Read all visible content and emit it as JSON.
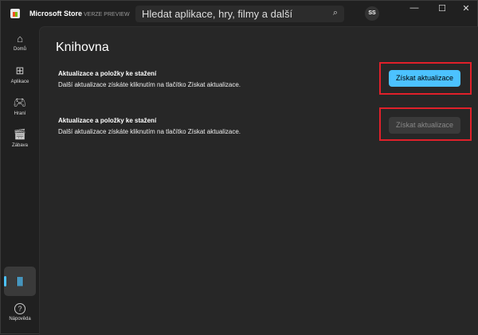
{
  "titlebar": {
    "app_name": "Microsoft Store",
    "badge": "VERZE PREVIEW",
    "search_placeholder": "Hledat aplikace, hry, filmy a další",
    "avatar": "SS",
    "minimize": "—",
    "maximize": "☐",
    "close": "✕"
  },
  "sidebar": {
    "items": [
      {
        "label": "Domů",
        "icon": "⌂"
      },
      {
        "label": "Aplikace",
        "icon": "⊞"
      },
      {
        "label": "Hraní",
        "icon": "🎮︎"
      },
      {
        "label": "Zábava",
        "icon": "🎬︎"
      }
    ],
    "library_icon": "|||",
    "help": {
      "label": "Nápověda",
      "icon": "?"
    }
  },
  "main": {
    "title": "Knihovna",
    "sections": [
      {
        "title": "Aktualizace a položky ke stažení",
        "desc": "Další aktualizace získáte kliknutím na tlačítko Získat aktualizace.",
        "button": "Získat aktualizace",
        "state": "enabled"
      },
      {
        "title": "Aktualizace a položky ke stažení",
        "desc": "Další aktualizace získáte kliknutím na tlačítko Získat aktualizace.",
        "button": "Získat aktualizace",
        "state": "disabled-loading"
      }
    ]
  },
  "colors": {
    "accent": "#4cc2ff",
    "highlight": "#e0202a"
  }
}
